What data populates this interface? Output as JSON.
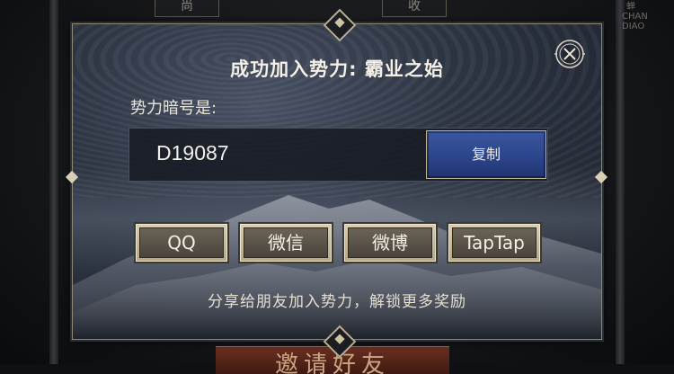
{
  "background": {
    "top_tabs": [
      "尚",
      "收"
    ],
    "side_text": "蝉 CHAN DIAO",
    "bottom_button": "邀请好友"
  },
  "dialog": {
    "title": "成功加入势力: 霸业之始",
    "code_label": "势力暗号是:",
    "code_value": "D19087",
    "copy_label": "复制",
    "share_buttons": [
      "QQ",
      "微信",
      "微博",
      "TapTap"
    ],
    "hint": "分享给朋友加入势力，解锁更多奖励"
  },
  "icons": {
    "close": "close-icon",
    "ornament": "diamond-ornament-icon"
  },
  "colors": {
    "copy_button": "#2b4488",
    "share_button_border": "#d9cdaf",
    "dialog_border": "#8d8778"
  }
}
